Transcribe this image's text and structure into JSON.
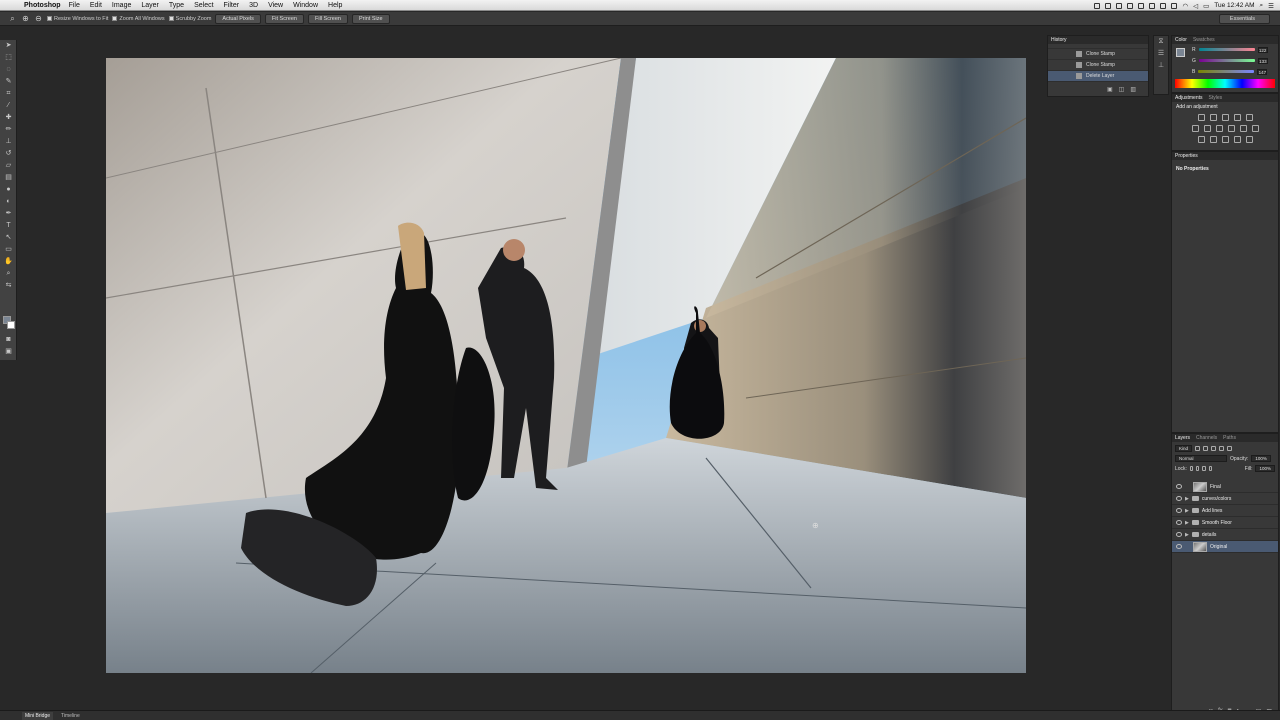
{
  "menubar": {
    "app_name": "Photoshop",
    "menus": [
      "File",
      "Edit",
      "Image",
      "Layer",
      "Type",
      "Select",
      "Filter",
      "3D",
      "View",
      "Window",
      "Help"
    ],
    "clock": "Tue 12:42 AM"
  },
  "options": {
    "resize_windows": "Resize Windows to Fit",
    "zoom_all": "Zoom All Windows",
    "scrubby_zoom": "Scrubby Zoom",
    "buttons": [
      "Actual Pixels",
      "Fit Screen",
      "Fill Screen",
      "Print Size"
    ],
    "workspace": "Essentials"
  },
  "history": {
    "title": "History",
    "items": [
      "Clone Stamp",
      "Clone Stamp",
      "Delete Layer"
    ],
    "selected_index": 2
  },
  "color_panel": {
    "tabs": [
      "Color",
      "Swatches"
    ],
    "sliders": [
      {
        "label": "R",
        "value": "122"
      },
      {
        "label": "G",
        "value": "133"
      },
      {
        "label": "B",
        "value": "147"
      }
    ]
  },
  "adjustments": {
    "tabs": [
      "Adjustments",
      "Styles"
    ],
    "heading": "Add an adjustment"
  },
  "properties": {
    "title": "Properties",
    "message": "No Properties"
  },
  "layers_panel": {
    "tabs": [
      "Layers",
      "Channels",
      "Paths"
    ],
    "filter": "Kind",
    "blend_mode": "Normal",
    "opacity_label": "Opacity:",
    "opacity": "100%",
    "fill_label": "Fill:",
    "fill": "100%",
    "lock_label": "Lock:",
    "layers": [
      {
        "name": "Final",
        "type": "image"
      },
      {
        "name": "curves/colors",
        "type": "group"
      },
      {
        "name": "Add lines",
        "type": "group"
      },
      {
        "name": "Smooth Floor",
        "type": "group"
      },
      {
        "name": "details",
        "type": "group"
      },
      {
        "name": "Original",
        "type": "image"
      }
    ],
    "selected_index": 5
  },
  "statusbar": {
    "tabs": [
      "Mini Bridge",
      "Timeline"
    ]
  },
  "colors": {
    "selection": "#4a5a72",
    "panel_bg": "#383838",
    "app_bg": "#282828"
  }
}
